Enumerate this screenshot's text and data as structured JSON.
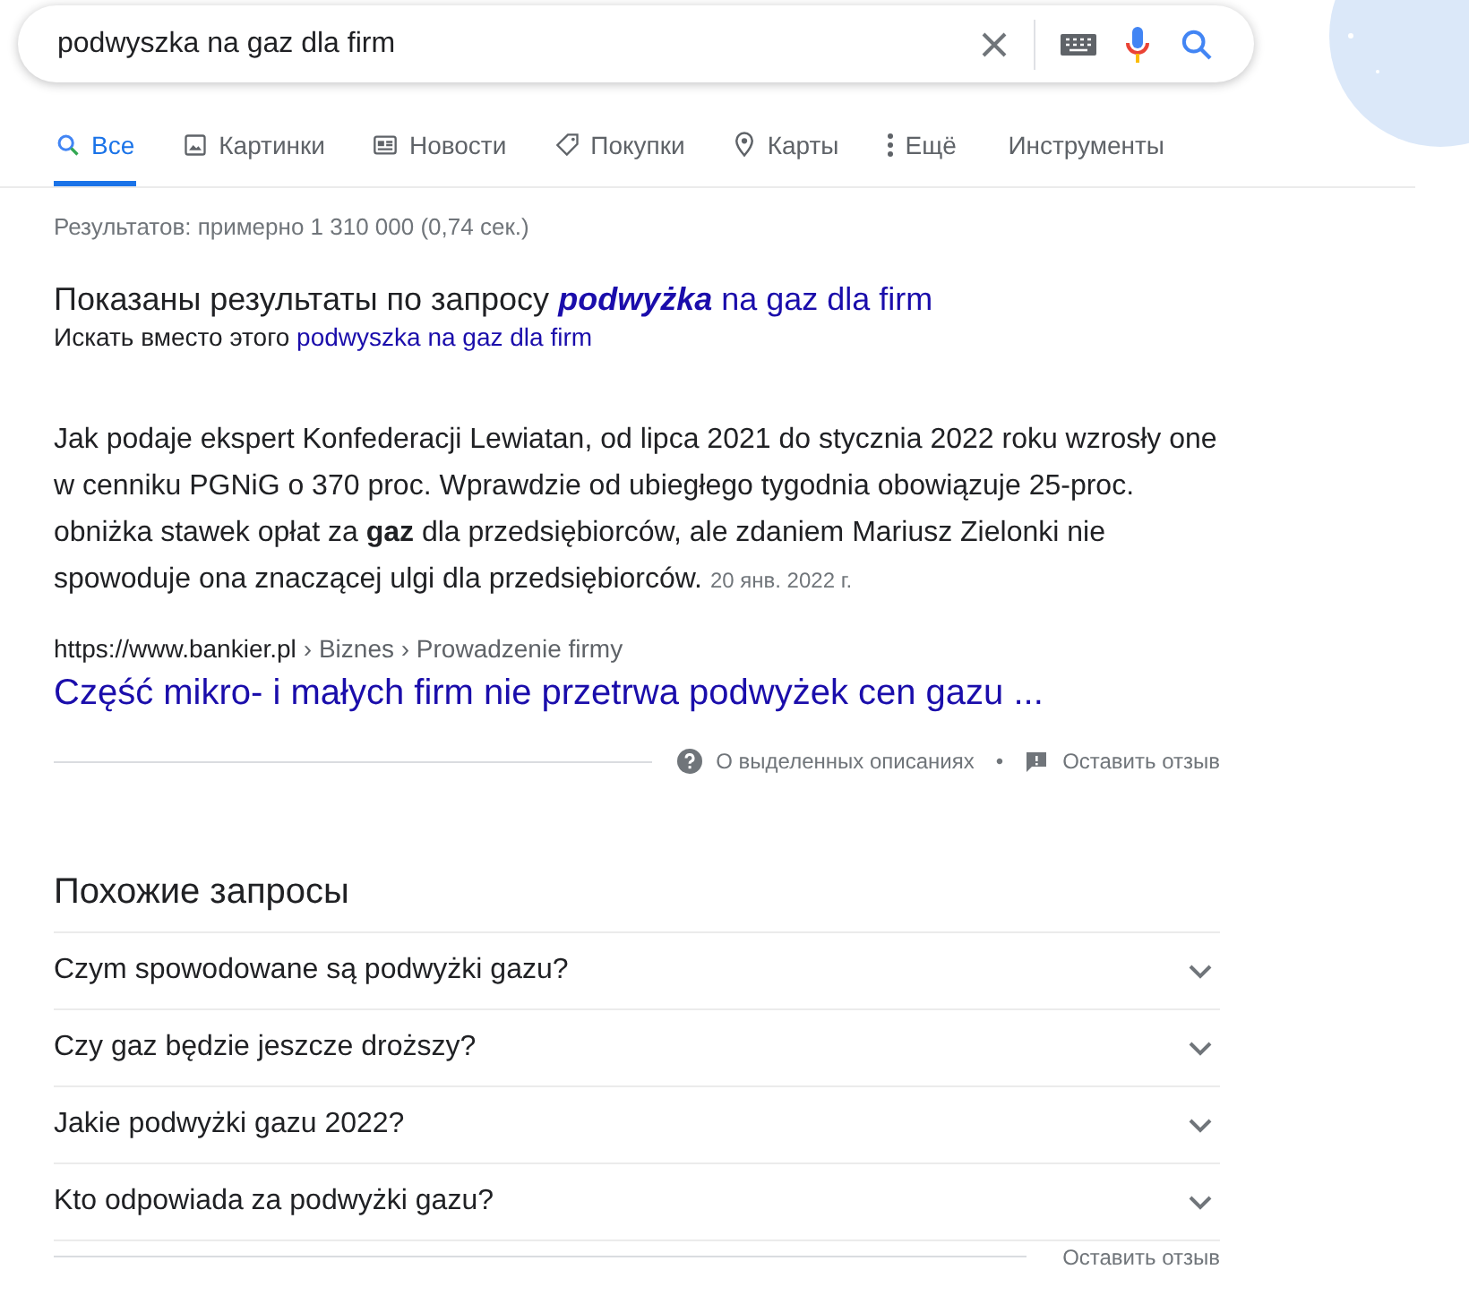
{
  "search": {
    "value": "podwyszka na gaz dla firm"
  },
  "tabs": [
    {
      "label": "Все",
      "kind": "search",
      "selected": true
    },
    {
      "label": "Картинки",
      "kind": "image",
      "selected": false
    },
    {
      "label": "Новости",
      "kind": "news",
      "selected": false
    },
    {
      "label": "Покупки",
      "kind": "tag",
      "selected": false
    },
    {
      "label": "Карты",
      "kind": "pin",
      "selected": false
    },
    {
      "label": "Ещё",
      "kind": "more",
      "selected": false
    }
  ],
  "tools": "Инструменты",
  "result_count": "Результатов: примерно 1 310 000 (0,74 сек.)",
  "spelling": {
    "shown_prefix": "Показаны результаты по запросу",
    "shown_link": "**podwyżka** na gaz dla firm",
    "instead_prefix": "Искать вместо этого",
    "instead_link": "podwyszka na gaz dla firm"
  },
  "snippet": {
    "text": "Jak podaje ekspert Konfederacji Lewiatan, od lipca 2021 do stycznia 2022 roku wzrosły one w cenniku PGNiG o 370 proc. Wprawdzie od ubiegłego tygodnia obowiązuje 25-proc. obniżka stawek opłat za **gaz** dla przedsiębiorców, ale zdaniem Mariusz Zielonki nie spowoduje ona znaczącej ulgi dla przedsiębiorców.",
    "date": "20 янв. 2022 г.",
    "url": "https://www.bankier.pl",
    "path": "› Biznes › Prowadzenie firmy",
    "title": "Część mikro- i małych firm nie przetrwa podwyżek cen gazu ...",
    "about": "О выделенных описаниях",
    "separator": "•",
    "feedback": "Оставить отзыв"
  },
  "related": {
    "title": "Похожие запросы",
    "items": [
      {
        "text": "Czym spowodowane są podwyżki gazu?",
        "expanded": false
      },
      {
        "text": "Czy gaz będzie jeszcze droższy?",
        "expanded": false
      },
      {
        "text": "Jakie podwyżki gazu 2022?",
        "expanded": false
      },
      {
        "text": "Kto odpowiada za podwyżki gazu?",
        "expanded": false
      }
    ],
    "feedback": "Оставить отзыв"
  }
}
